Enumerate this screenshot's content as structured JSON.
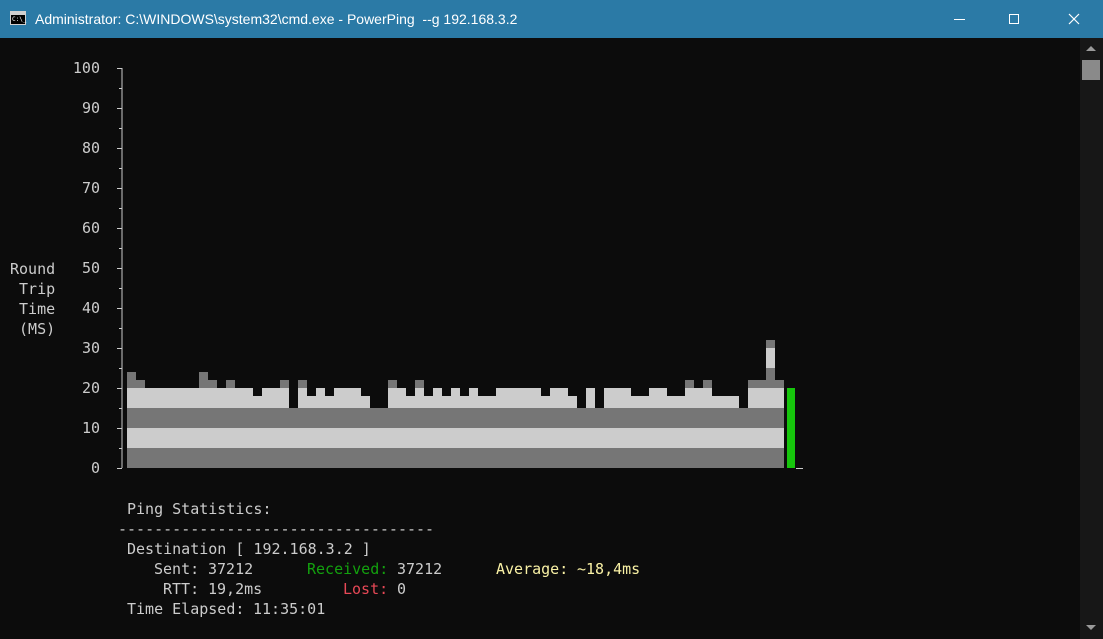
{
  "window": {
    "title": "Administrator: C:\\WINDOWS\\system32\\cmd.exe - PowerPing  --g 192.168.3.2",
    "icon_text": "C:\\_",
    "icons": {
      "app": "cmd-icon",
      "minimize": "minimize-icon",
      "maximize": "maximize-icon",
      "close": "close-icon"
    }
  },
  "graph": {
    "ylabel_lines": [
      "Round",
      " Trip",
      " Time",
      " (MS)"
    ],
    "yticks": [
      {
        "label": "100",
        "value": 100
      },
      {
        "label": "90",
        "value": 90
      },
      {
        "label": "80",
        "value": 80
      },
      {
        "label": "70",
        "value": 70
      },
      {
        "label": "60",
        "value": 60
      },
      {
        "label": "50",
        "value": 50
      },
      {
        "label": "40",
        "value": 40
      },
      {
        "label": "30",
        "value": 30
      },
      {
        "label": "20",
        "value": 20
      },
      {
        "label": "10",
        "value": 10
      },
      {
        "label": "0",
        "value": 0
      }
    ]
  },
  "chart_data": {
    "type": "bar",
    "ylabel": "Round Trip Time (MS)",
    "ylim": [
      0,
      100
    ],
    "values": [
      24,
      22,
      20,
      20,
      20,
      20,
      20,
      20,
      24,
      22,
      20,
      22,
      20,
      20,
      18,
      20,
      20,
      22,
      15,
      22,
      18,
      20,
      18,
      20,
      20,
      20,
      18,
      15,
      15,
      22,
      20,
      18,
      22,
      18,
      20,
      18,
      20,
      18,
      20,
      18,
      18,
      20,
      20,
      20,
      20,
      20,
      18,
      20,
      20,
      18,
      15,
      20,
      15,
      20,
      20,
      20,
      18,
      18,
      20,
      20,
      18,
      18,
      22,
      20,
      22,
      18,
      18,
      18,
      15,
      22,
      22,
      32,
      22
    ],
    "latest_value": 20,
    "colors": {
      "light": "#cccccc",
      "dark": "#767676",
      "latest": "#16c60c",
      "axis": "#cccccc"
    }
  },
  "stats": {
    "header": "Ping Statistics:",
    "divider": "-----------------------------------",
    "destination_line": "Destination [ 192.168.3.2 ]",
    "sent_label": "Sent:",
    "sent_value": "37212",
    "received_label": "Received:",
    "received_value": "37212",
    "average_label": "Average:",
    "average_value": "~18,4ms",
    "rtt_label": "RTT:",
    "rtt_value": "19,2ms",
    "lost_label": "Lost:",
    "lost_value": "0",
    "elapsed_label": "Time Elapsed:",
    "elapsed_value": "11:35:01",
    "colors": {
      "text": "#cccccc",
      "received": "#13a10e",
      "lost": "#e74856",
      "average": "#f9f1a5"
    }
  }
}
